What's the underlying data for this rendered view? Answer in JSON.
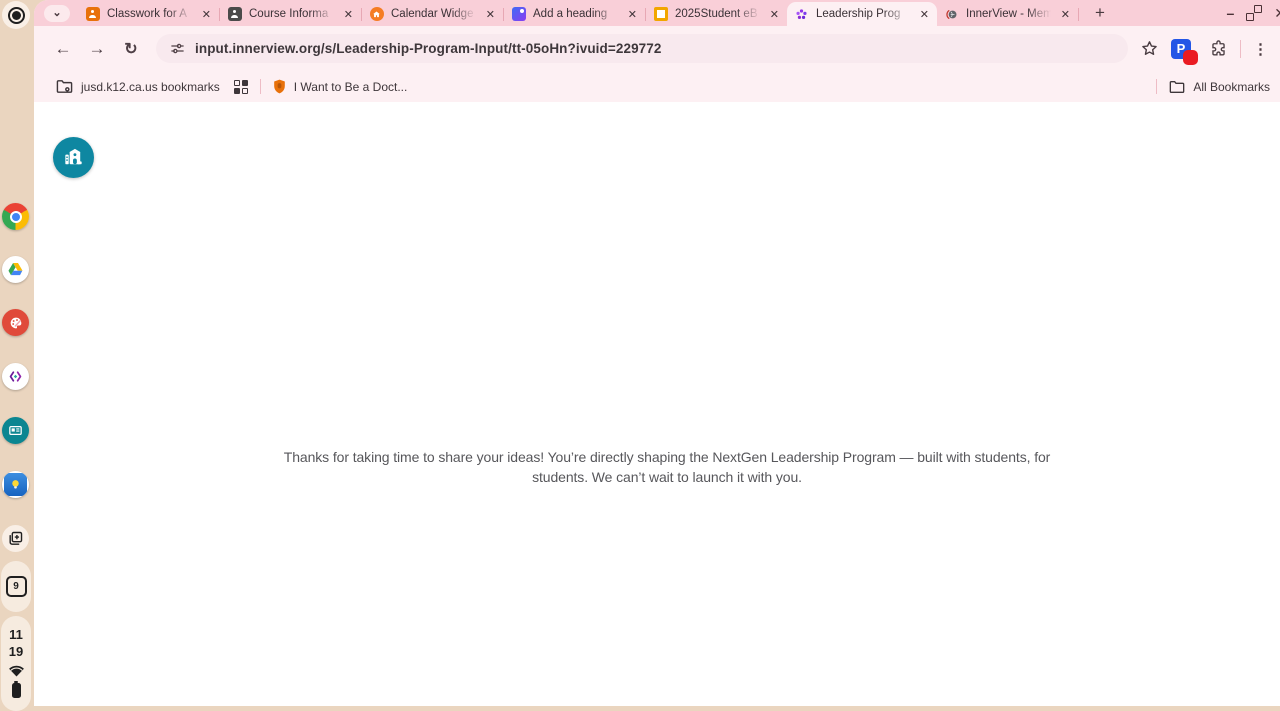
{
  "tabstrip": {
    "tabs": [
      {
        "title": "Classwork for A",
        "icon": "classroom-person-orange",
        "active": false
      },
      {
        "title": "Course Informa",
        "icon": "classroom-person-dark",
        "active": false
      },
      {
        "title": "Calendar Widge",
        "icon": "home-orange",
        "active": false
      },
      {
        "title": "Add a heading",
        "icon": "gradient-tile-blue",
        "active": false
      },
      {
        "title": "2025Student eB",
        "icon": "slides-yellow",
        "active": false
      },
      {
        "title": "Leadership Prog",
        "icon": "flower-purple",
        "active": true
      },
      {
        "title": "InnerView - Mem",
        "icon": "globe-gray",
        "active": false
      }
    ]
  },
  "toolbar": {
    "url": "input.innerview.org/s/Leadership-Program-Input/tt-05oHn?ivuid=229772"
  },
  "bookmarks_bar": {
    "managed_folder_label": "jusd.k12.ca.us bookmarks",
    "bookmark_label": "I Want to Be a Doct...",
    "all_bookmarks_label": "All Bookmarks"
  },
  "page": {
    "message": "Thanks for taking  time to share your ideas! You’re directly shaping the NextGen Leadership Program — built with students, for students. We can’t wait to launch it with you."
  },
  "shelf": {
    "clock_hour": "11",
    "clock_minute": "19",
    "calendar_day": "9",
    "apps": [
      "launcher",
      "chrome",
      "google-drive",
      "chrome-canvas",
      "xello",
      "id-card-app",
      "lightbulb-app",
      "screen-capture"
    ]
  },
  "icons": {
    "close": "✕",
    "plus": "+",
    "menu": "⋮",
    "minimize": "–",
    "chevron_down": "⌄",
    "back": "←",
    "forward": "→",
    "reload": "↻"
  },
  "colors": {
    "accent_teal": "#0e87a1",
    "tabstrip_pink": "#f9cfd8",
    "frame_pink": "#fdf0f3",
    "shelf_beige": "#ead5bf",
    "url_pill_pink": "#f8e9ee"
  }
}
